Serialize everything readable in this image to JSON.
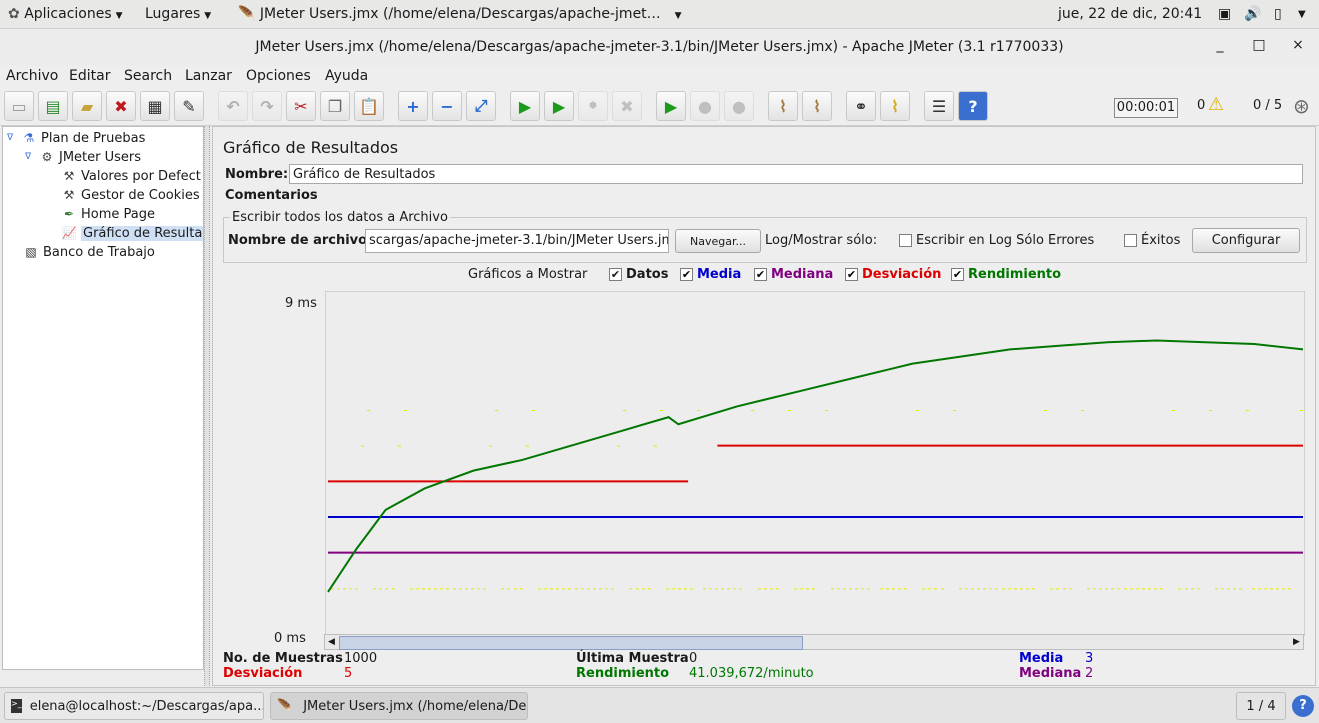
{
  "topbar": {
    "apps_label": "Aplicaciones",
    "places_label": "Lugares",
    "active_window": "JMeter Users.jmx (/home/elena/Descargas/apache-jmet…",
    "clock": "jue, 22 de dic, 20:41"
  },
  "window": {
    "title": "JMeter Users.jmx (/home/elena/Descargas/apache-jmeter-3.1/bin/JMeter Users.jmx) - Apache JMeter (3.1 r1770033)",
    "minimize": "_",
    "maximize": "□",
    "close": "×"
  },
  "menu": [
    "Archivo",
    "Editar",
    "Search",
    "Lanzar",
    "Opciones",
    "Ayuda"
  ],
  "toolbar": {
    "timer": "00:00:01",
    "warnings": "0",
    "threads": "0 / 5"
  },
  "tree": {
    "items": [
      {
        "label": "Plan de Pruebas",
        "icon": "flask-icon"
      },
      {
        "label": "JMeter Users",
        "icon": "gear-icon"
      },
      {
        "label": "Valores por Defect",
        "icon": "wrench-icon"
      },
      {
        "label": "Gestor de Cookies",
        "icon": "wrench-icon"
      },
      {
        "label": "Home Page",
        "icon": "pipette-icon"
      },
      {
        "label": "Gráfico de Resulta",
        "icon": "graph-icon"
      },
      {
        "label": "Banco de Trabajo",
        "icon": "workbench-icon"
      }
    ]
  },
  "panel": {
    "heading": "Gráfico de Resultados",
    "name_label": "Nombre:",
    "name_value": "Gráfico de Resultados",
    "comments_label": "Comentarios",
    "file_section": "Escribir todos los datos a Archivo",
    "filename_label": "Nombre de archivo",
    "filename_value": "scargas/apache-jmeter-3.1/bin/JMeter Users.jmx",
    "browse_button": "Navegar...",
    "log_label": "Log/Mostrar sólo:",
    "errors_only": "Escribir en Log Sólo Errores",
    "successes": "Éxitos",
    "configure_button": "Configurar",
    "graphs_label": "Gráficos a Mostrar",
    "graph_toggles": [
      {
        "label": "Datos",
        "color": "#000000"
      },
      {
        "label": "Media",
        "color": "#0000cc"
      },
      {
        "label": "Mediana",
        "color": "#800080"
      },
      {
        "label": "Desviación",
        "color": "#dd0000"
      },
      {
        "label": "Rendimiento",
        "color": "#007700"
      }
    ]
  },
  "chart_data": {
    "type": "line",
    "ylim": [
      0,
      9
    ],
    "y_unit": "ms",
    "y_ticks": [
      "9 ms",
      "0 ms"
    ],
    "series": [
      {
        "name": "Media",
        "color": "#0000cc",
        "x": [
          1,
          1000
        ],
        "values": [
          3,
          3
        ]
      },
      {
        "name": "Mediana",
        "color": "#800080",
        "x": [
          1,
          1000
        ],
        "values": [
          2,
          2
        ]
      },
      {
        "name": "Desviación",
        "color": "#dd0000",
        "x": [
          1,
          370,
          400,
          1000
        ],
        "values": [
          4,
          4,
          5,
          5
        ]
      },
      {
        "name": "Rendimiento",
        "color": "#007700",
        "x": [
          1,
          30,
          60,
          100,
          150,
          200,
          250,
          300,
          350,
          360,
          420,
          480,
          540,
          600,
          650,
          700,
          750,
          800,
          850,
          900,
          950,
          1000
        ],
        "values": [
          0.9,
          2.1,
          3.2,
          3.8,
          4.3,
          4.6,
          5.0,
          5.4,
          5.8,
          5.6,
          6.1,
          6.5,
          6.9,
          7.3,
          7.5,
          7.7,
          7.8,
          7.9,
          7.95,
          7.9,
          7.85,
          7.7
        ]
      }
    ]
  },
  "stats": {
    "samples_label": "No. de Muestras",
    "samples_value": "1000",
    "last_label": "Última Muestra",
    "last_value": "0",
    "mean_label": "Media",
    "mean_value": "3",
    "deviation_label": "Desviación",
    "deviation_value": "5",
    "throughput_label": "Rendimiento",
    "throughput_value": "41.039,672/minuto",
    "median_label": "Mediana",
    "median_value": "2"
  },
  "taskbar": {
    "task1": "elena@localhost:~/Descargas/apa...",
    "task2": "JMeter Users.jmx (/home/elena/De...",
    "workspace": "1 / 4",
    "help": "?"
  }
}
